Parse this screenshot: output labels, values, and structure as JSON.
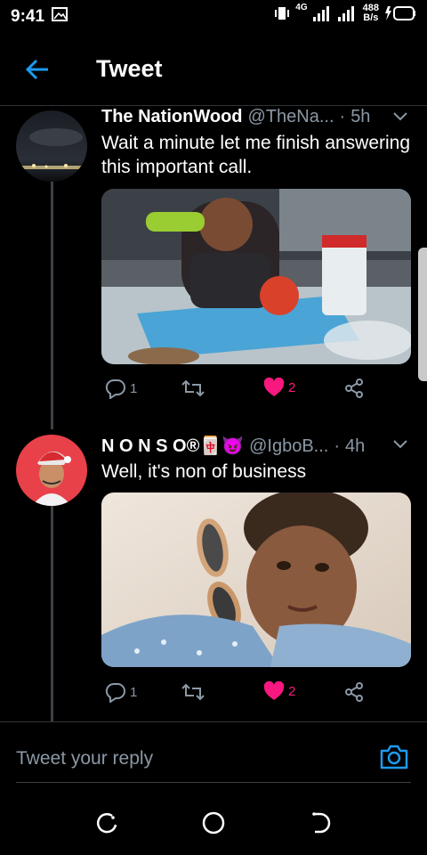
{
  "status_bar": {
    "time": "9:41",
    "network_label": "4G",
    "net_speed_value": "488",
    "net_speed_unit": "B/s"
  },
  "app_bar": {
    "title": "Tweet"
  },
  "tweets": [
    {
      "author": "The NationWood",
      "handle": "@TheNa...",
      "dot": "·",
      "time": "5h",
      "text": "Wait a minute let me finish answering this important call.",
      "actions": {
        "replies": "1",
        "likes": "2"
      }
    },
    {
      "author": "N O N S O®🀄😈",
      "handle": "@IgboB...",
      "dot": "·",
      "time": "4h",
      "text": "Well, it's non of business",
      "actions": {
        "replies": "1",
        "likes": "2"
      }
    }
  ],
  "reply": {
    "placeholder": "Tweet your reply"
  },
  "colors": {
    "accent": "#1d9bf0",
    "like": "#f91880",
    "muted": "#8b98a5"
  }
}
